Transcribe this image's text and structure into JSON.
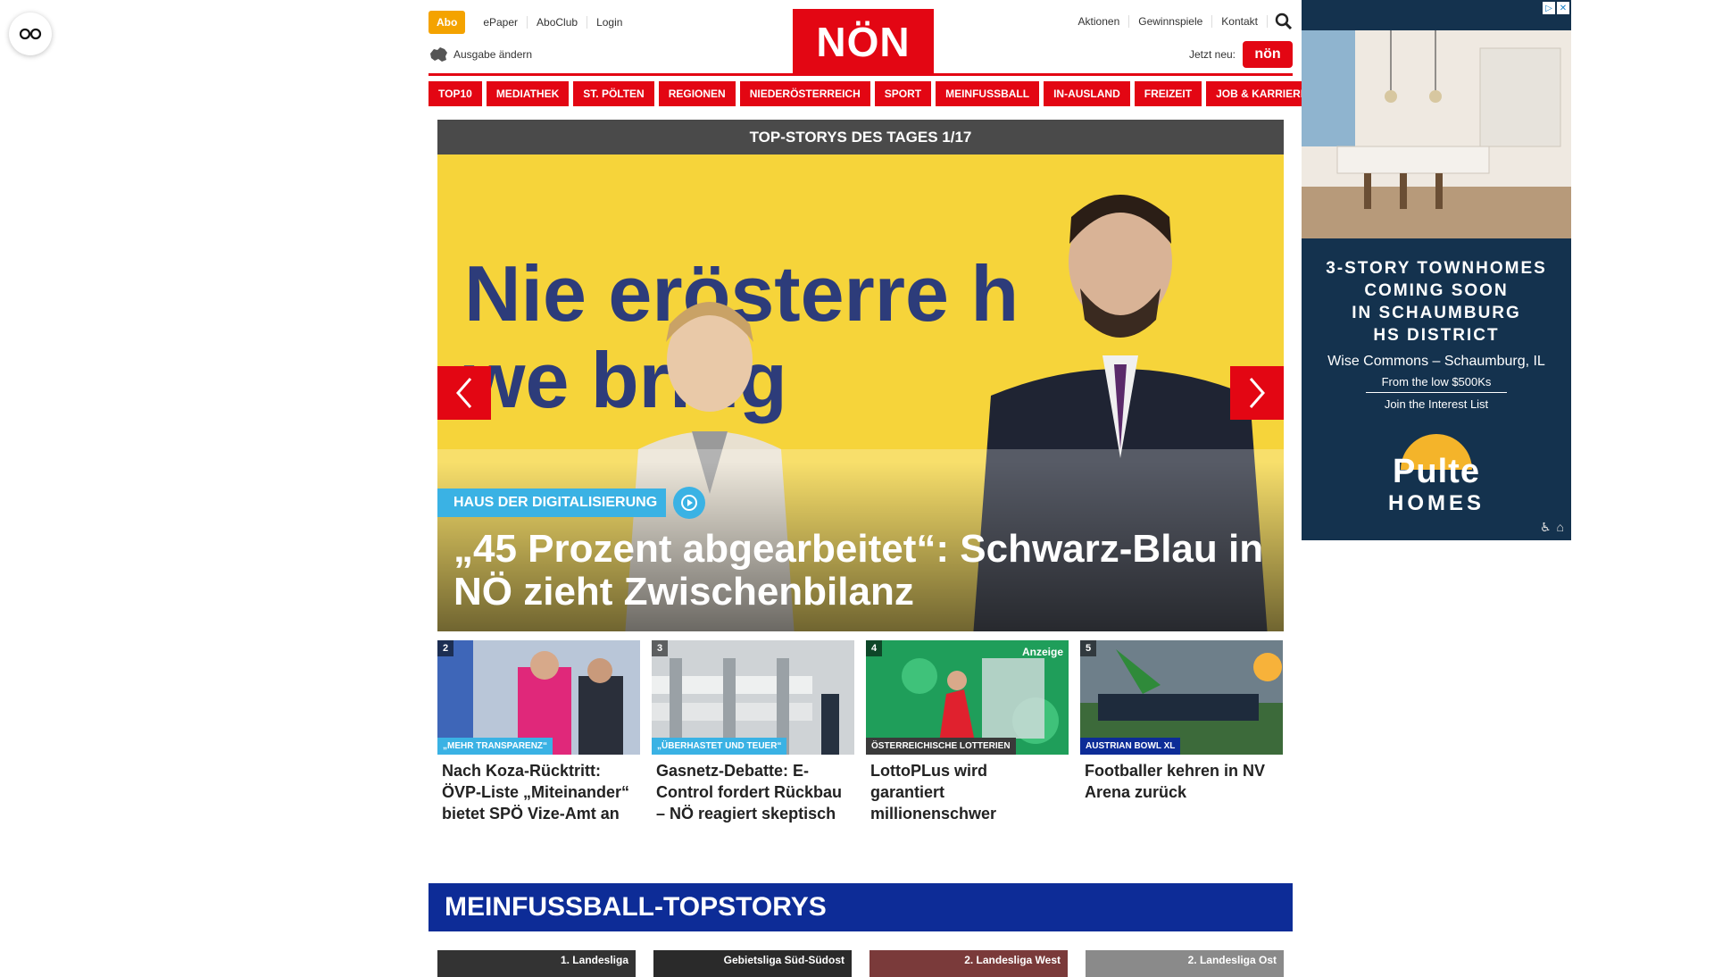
{
  "header": {
    "abo": "Abo",
    "left_links": [
      "ePaper",
      "AboClub",
      "Login"
    ],
    "edition": "Ausgabe ändern",
    "logo": "NÖN",
    "right_links": [
      "Aktionen",
      "Gewinnspiele",
      "Kontakt"
    ],
    "jetzt_neu": "Jetzt neu:",
    "jetzt_badge": "nön"
  },
  "nav": [
    "TOP10",
    "MEDIATHEK",
    "ST. PÖLTEN",
    "REGIONEN",
    "NIEDERÖSTERREICH",
    "SPORT",
    "MEINFUSSBALL",
    "IN-AUSLAND",
    "FREIZEIT",
    "JOB & KARRIERE"
  ],
  "hero": {
    "header": "TOP-STORYS DES TAGES 1/17",
    "background_text_line1": "Nie  erösterre  h",
    "background_text_line2": "we   bring",
    "kicker": "HAUS DER DIGITALISIERUNG",
    "title": "„45 Prozent abgearbeitet“: Schwarz-Blau in NÖ zieht Zwischenbilanz"
  },
  "cards": [
    {
      "num": "2",
      "tag": "„MEHR TRANSPARENZ“",
      "tag_color": "#3ab2e4",
      "title": "Nach Koza-Rücktritt: ÖVP-Liste „Miteinander“ bietet SPÖ Vize-Amt an",
      "ad": ""
    },
    {
      "num": "3",
      "tag": "„ÜBERHASTET UND TEUER“",
      "tag_color": "#3ab2e4",
      "title": "Gasnetz-Debatte: E-Control fordert Rückbau – NÖ reagiert skeptisch",
      "ad": ""
    },
    {
      "num": "4",
      "tag": "ÖSTERREICHISCHE LOTTERIEN",
      "tag_color": "#3a3a3a",
      "title": "LottoPLus wird garantiert millionenschwer",
      "ad": "Anzeige"
    },
    {
      "num": "5",
      "tag": "AUSTRIAN BOWL XL",
      "tag_color": "#0d2c97",
      "title": "Footballer kehren in NV Arena zurück",
      "ad": ""
    }
  ],
  "meinfussball": {
    "title": "MEINFUSSBALL-TOPSTORYS",
    "labels": [
      "1. Landesliga",
      "Gebietsliga Süd-Südost",
      "2. Landesliga West",
      "2. Landesliga Ost"
    ]
  },
  "ad": {
    "headline": [
      "3-STORY TOWNHOMES",
      "COMING SOON",
      "IN SCHAUMBURG",
      "HS DISTRICT"
    ],
    "sub": "Wise Commons – Schaumburg, IL",
    "price": "From the low $500Ks",
    "join": "Join the Interest List",
    "brand": [
      "Pulte",
      "HOMES"
    ]
  },
  "colors": {
    "brand_red": "#e30613",
    "accent_blue": "#3ab2e4",
    "fussball_blue": "#0d2c97",
    "abo_orange": "#f4a300"
  }
}
